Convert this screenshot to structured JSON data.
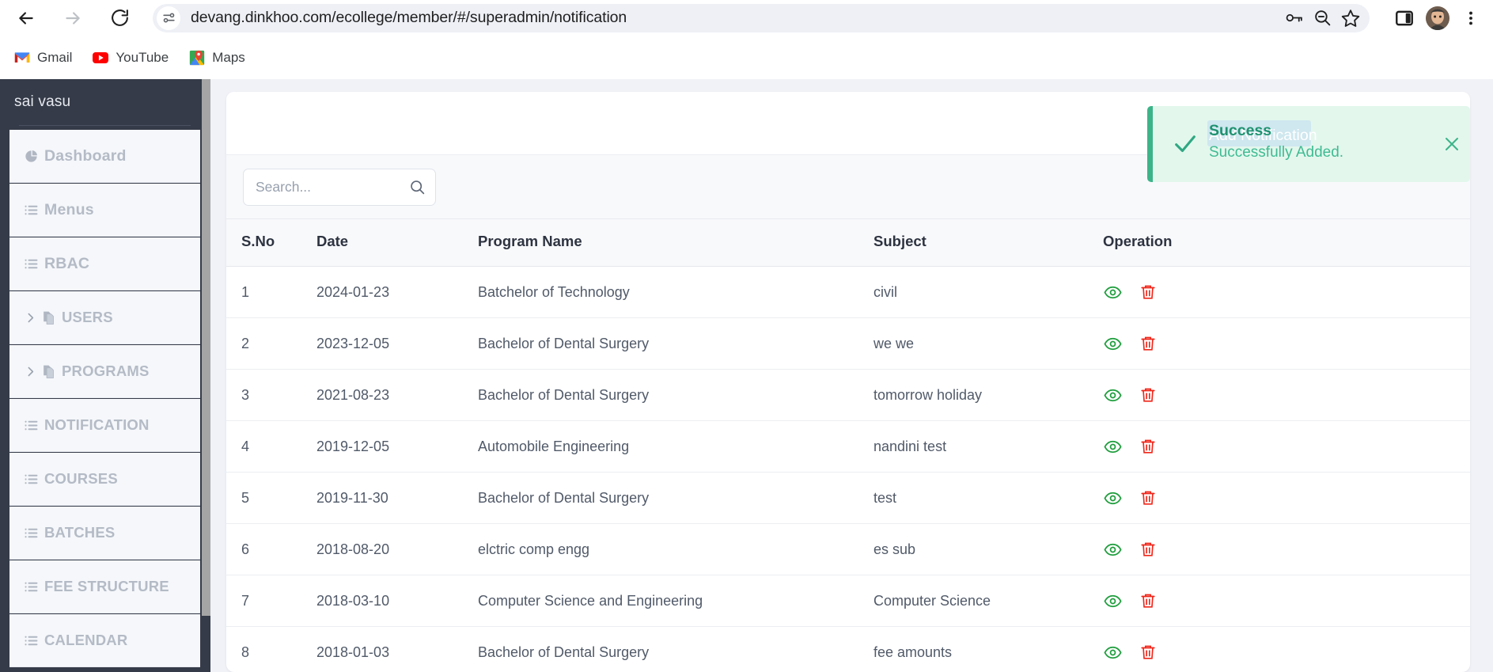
{
  "browser": {
    "url": "devang.dinkhoo.com/ecollege/member/#/superadmin/notification",
    "nav": {
      "back": "back-arrow-icon",
      "forward": "forward-arrow-icon",
      "reload": "reload-icon",
      "site_info": "site-settings-icon"
    },
    "omnibox_actions": [
      {
        "name": "password-key-icon",
        "label": "Save password"
      },
      {
        "name": "zoom-out-icon",
        "label": "Zoom"
      },
      {
        "name": "bookmark-star-icon",
        "label": "Bookmark this tab"
      }
    ],
    "right_actions": [
      {
        "name": "side-panel-icon",
        "label": "Side panel"
      },
      {
        "name": "profile-avatar",
        "label": "Profile"
      },
      {
        "name": "chrome-menu-icon",
        "label": "Customize and control Chrome"
      }
    ],
    "bookmarks": [
      {
        "label": "Gmail",
        "icon": "gmail-icon"
      },
      {
        "label": "YouTube",
        "icon": "youtube-icon"
      },
      {
        "label": "Maps",
        "icon": "google-maps-icon"
      }
    ]
  },
  "sidebar": {
    "brand": "sai vasu",
    "items": [
      {
        "label": "Dashboard",
        "icon": "pie-chart-icon",
        "caret": false,
        "caps": false
      },
      {
        "label": "Menus",
        "icon": "list-icon",
        "caret": false,
        "caps": false
      },
      {
        "label": "RBAC",
        "icon": "list-icon",
        "caret": false,
        "caps": false
      },
      {
        "label": "USERS",
        "icon": "copy-icon",
        "caret": true,
        "caps": true
      },
      {
        "label": "PROGRAMS",
        "icon": "copy-icon",
        "caret": true,
        "caps": true
      },
      {
        "label": "NOTIFICATION",
        "icon": "list-icon",
        "caret": false,
        "caps": true
      },
      {
        "label": "COURSES",
        "icon": "list-icon",
        "caret": false,
        "caps": true
      },
      {
        "label": "BATCHES",
        "icon": "list-icon",
        "caret": false,
        "caps": true
      },
      {
        "label": "FEE STRUCTURE",
        "icon": "list-icon",
        "caret": false,
        "caps": true
      },
      {
        "label": "CALENDAR",
        "icon": "list-icon",
        "caret": false,
        "caps": true
      }
    ]
  },
  "search": {
    "placeholder": "Search...",
    "value": "",
    "icon": "search-icon"
  },
  "table": {
    "columns": [
      "S.No",
      "Date",
      "Program Name",
      "Subject",
      "Operation"
    ],
    "rows": [
      {
        "sno": "1",
        "date": "2024-01-23",
        "program": "Batchelor of Technology",
        "subject": "civil"
      },
      {
        "sno": "2",
        "date": "2023-12-05",
        "program": "Bachelor of Dental Surgery",
        "subject": "we we"
      },
      {
        "sno": "3",
        "date": "2021-08-23",
        "program": "Bachelor of Dental Surgery",
        "subject": "tomorrow holiday"
      },
      {
        "sno": "4",
        "date": "2019-12-05",
        "program": "Automobile Engineering",
        "subject": "nandini test"
      },
      {
        "sno": "5",
        "date": "2019-11-30",
        "program": "Bachelor of Dental Surgery",
        "subject": "test"
      },
      {
        "sno": "6",
        "date": "2018-08-20",
        "program": "elctric comp engg",
        "subject": "es sub"
      },
      {
        "sno": "7",
        "date": "2018-03-10",
        "program": "Computer Science and Engineering",
        "subject": "Computer Science"
      },
      {
        "sno": "8",
        "date": "2018-01-03",
        "program": "Bachelor of Dental Surgery",
        "subject": "fee amounts"
      }
    ],
    "operations": [
      {
        "name": "view-icon",
        "label": "View",
        "color": "#1f9e3d"
      },
      {
        "name": "delete-icon",
        "label": "Delete",
        "color": "#f0261a"
      }
    ]
  },
  "toast": {
    "title": "Success",
    "ghost_title": "Add Notification",
    "message": "Successfully Added.",
    "check_icon": "checkmark-icon",
    "close_icon": "close-icon",
    "accent": "#3cb489",
    "background": "#e3f7ed"
  }
}
